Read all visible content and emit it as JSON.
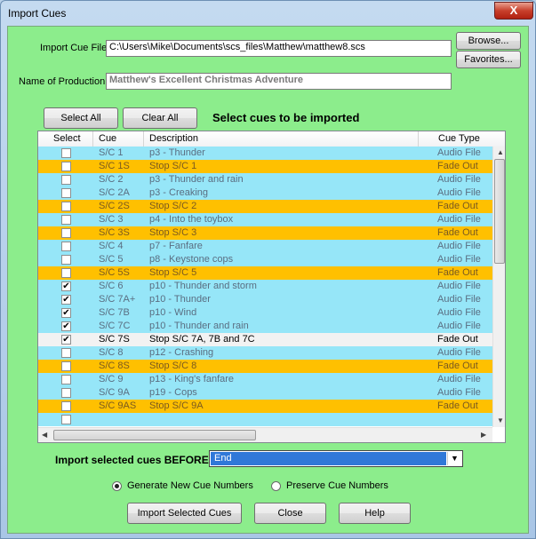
{
  "window": {
    "title": "Import Cues",
    "close_label": "X"
  },
  "import_file": {
    "label": "Import Cue File",
    "value": "C:\\Users\\Mike\\Documents\\scs_files\\Matthew\\matthew8.scs",
    "browse_label": "Browse...",
    "favorites_label": "Favorites..."
  },
  "production": {
    "label": "Name of Production",
    "value": "Matthew's Excellent Christmas Adventure"
  },
  "actions": {
    "select_all": "Select All",
    "clear_all": "Clear All",
    "heading": "Select cues to be imported"
  },
  "grid": {
    "columns": [
      "Select",
      "Cue",
      "Description",
      "Cue Type"
    ],
    "colors": {
      "audio": "#96e6f8",
      "fade": "#ffc000",
      "plain": "#f2f2f2",
      "audio_text": "#5a6e82",
      "fade_text": "#7a5a20"
    },
    "rows": [
      {
        "checked": false,
        "cue": "S/C 1",
        "desc": "p3 - Thunder",
        "type": "Audio File",
        "kind": "audio"
      },
      {
        "checked": false,
        "cue": "S/C 1S",
        "desc": "Stop S/C 1",
        "type": "Fade Out",
        "kind": "fade"
      },
      {
        "checked": false,
        "cue": "S/C 2",
        "desc": "p3 - Thunder and rain",
        "type": "Audio File",
        "kind": "audio"
      },
      {
        "checked": false,
        "cue": "S/C 2A",
        "desc": "p3 - Creaking",
        "type": "Audio File",
        "kind": "audio"
      },
      {
        "checked": false,
        "cue": "S/C 2S",
        "desc": "Stop S/C 2",
        "type": "Fade Out",
        "kind": "fade"
      },
      {
        "checked": false,
        "cue": "S/C 3",
        "desc": "p4 - Into the toybox",
        "type": "Audio File",
        "kind": "audio"
      },
      {
        "checked": false,
        "cue": "S/C 3S",
        "desc": "Stop S/C 3",
        "type": "Fade Out",
        "kind": "fade"
      },
      {
        "checked": false,
        "cue": "S/C 4",
        "desc": "p7 - Fanfare",
        "type": "Audio File",
        "kind": "audio"
      },
      {
        "checked": false,
        "cue": "S/C 5",
        "desc": "p8 - Keystone cops",
        "type": "Audio File",
        "kind": "audio"
      },
      {
        "checked": false,
        "cue": "S/C 5S",
        "desc": "Stop S/C 5",
        "type": "Fade Out",
        "kind": "fade"
      },
      {
        "checked": true,
        "cue": "S/C 6",
        "desc": "p10 - Thunder and storm",
        "type": "Audio File",
        "kind": "audio"
      },
      {
        "checked": true,
        "cue": "S/C 7A+",
        "desc": "p10 - Thunder",
        "type": "Audio File",
        "kind": "audio"
      },
      {
        "checked": true,
        "cue": "S/C 7B",
        "desc": "p10 - Wind",
        "type": "Audio File",
        "kind": "audio"
      },
      {
        "checked": true,
        "cue": "S/C 7C",
        "desc": "p10 - Thunder and rain",
        "type": "Audio File",
        "kind": "audio"
      },
      {
        "checked": true,
        "cue": "S/C 7S",
        "desc": "Stop S/C 7A, 7B and 7C",
        "type": "Fade Out",
        "kind": "plain"
      },
      {
        "checked": false,
        "cue": "S/C 8",
        "desc": "p12 - Crashing",
        "type": "Audio File",
        "kind": "audio"
      },
      {
        "checked": false,
        "cue": "S/C 8S",
        "desc": "Stop S/C 8",
        "type": "Fade Out",
        "kind": "fade"
      },
      {
        "checked": false,
        "cue": "S/C 9",
        "desc": "p13 - King's fanfare",
        "type": "Audio File",
        "kind": "audio"
      },
      {
        "checked": false,
        "cue": "S/C 9A",
        "desc": "p19 - Cops",
        "type": "Audio File",
        "kind": "audio"
      },
      {
        "checked": false,
        "cue": "S/C 9AS",
        "desc": "Stop S/C 9A",
        "type": "Fade Out",
        "kind": "fade"
      },
      {
        "checked": false,
        "cue": "",
        "desc": "",
        "type": "",
        "kind": "audio"
      }
    ]
  },
  "import_before": {
    "label": "Import selected cues BEFORE",
    "value": "End"
  },
  "numbering": {
    "generate_label": "Generate New Cue Numbers",
    "preserve_label": "Preserve Cue Numbers",
    "selected": "generate"
  },
  "buttons": {
    "import": "Import Selected Cues",
    "close": "Close",
    "help": "Help"
  }
}
